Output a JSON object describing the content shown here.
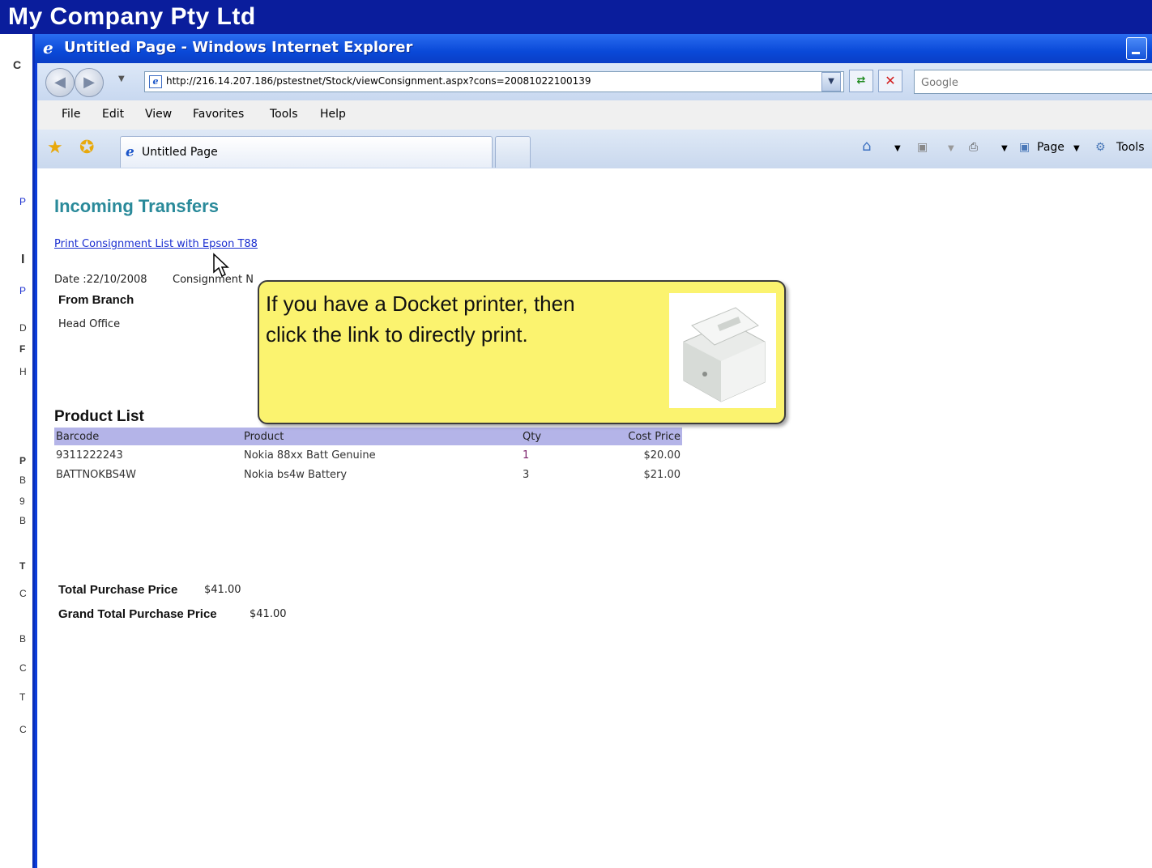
{
  "background_app": {
    "title": "My Company Pty Ltd"
  },
  "window": {
    "title": "Untitled Page - Windows Internet Explorer"
  },
  "toolbar": {
    "url": "http://216.14.207.186/pstestnet/Stock/viewConsignment.aspx?cons=20081022100139",
    "search_placeholder": "Google"
  },
  "menu": [
    "File",
    "Edit",
    "View",
    "Favorites",
    "Tools",
    "Help"
  ],
  "tabs": [
    {
      "label": "Untitled Page"
    }
  ],
  "command_bar": {
    "page": "Page",
    "tools": "Tools"
  },
  "page": {
    "heading": "Incoming Transfers",
    "print_link": "Print Consignment List with Epson T88",
    "date_label": "Date :22/10/2008",
    "consignment_label": "Consignment N",
    "from_branch_label": "From Branch",
    "from_branch_value": "Head Office",
    "product_list_heading": "Product List",
    "table": {
      "headers": [
        "Barcode",
        "Product",
        "Qty",
        "Cost Price"
      ],
      "rows": [
        [
          "9311222243",
          "Nokia 88xx Batt Genuine",
          "1",
          "$20.00"
        ],
        [
          "BATTNOKBS4W",
          "Nokia bs4w Battery",
          "3",
          "$21.00"
        ]
      ]
    },
    "total_label": "Total Purchase Price",
    "total_value": "$41.00",
    "grand_total_label": "Grand Total Purchase Price",
    "grand_total_value": "$41.00"
  },
  "callout": {
    "line1": "If you have a Docket printer, then",
    "line2": "click the link to directly print."
  }
}
